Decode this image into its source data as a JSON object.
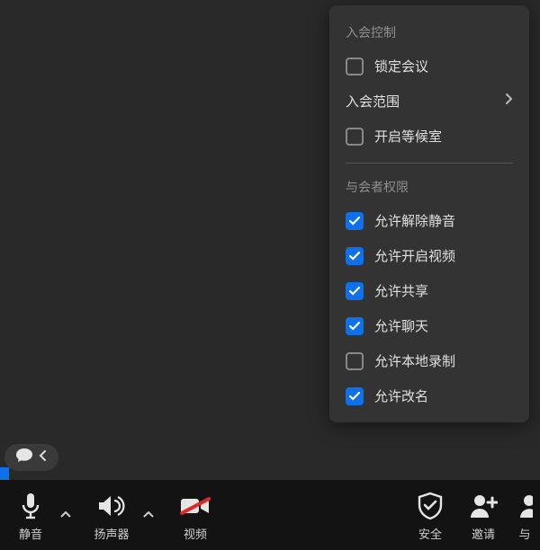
{
  "popup": {
    "section1_title": "入会控制",
    "lock_meeting": {
      "label": "锁定会议",
      "checked": false
    },
    "join_scope": {
      "label": "入会范围"
    },
    "waiting_room": {
      "label": "开启等候室",
      "checked": false
    },
    "section2_title": "与会者权限",
    "permissions": [
      {
        "label": "允许解除静音",
        "checked": true
      },
      {
        "label": "允许开启视频",
        "checked": true
      },
      {
        "label": "允许共享",
        "checked": true
      },
      {
        "label": "允许聊天",
        "checked": true
      },
      {
        "label": "允许本地录制",
        "checked": false
      },
      {
        "label": "允许改名",
        "checked": true
      }
    ]
  },
  "toolbar": {
    "mute": "静音",
    "speaker": "扬声器",
    "video": "视频",
    "security": "安全",
    "invite": "邀请",
    "with_prefix": "与"
  }
}
